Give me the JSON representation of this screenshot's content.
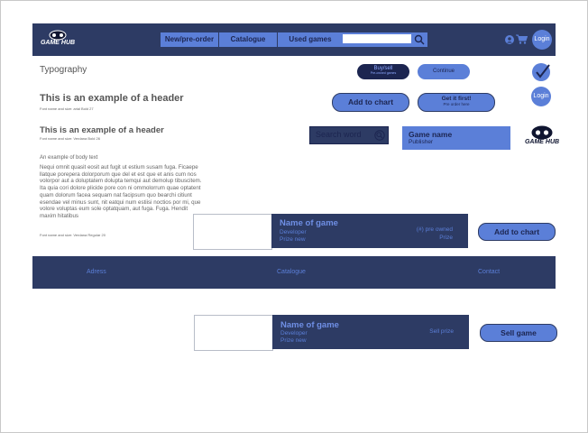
{
  "header": {
    "logo_text": "GAME HUB",
    "nav": [
      "New/pre-order",
      "Catalogue",
      "Used games"
    ],
    "search_placeholder": "",
    "login": "Login"
  },
  "typography": {
    "title": "Typography",
    "h1": "This is an example of a header",
    "h1_font": "Font name and size: arial Bold 27",
    "h2": "This is an example of a header",
    "h2_font": "Font name and size: Verdana Bold 26",
    "body_label": "An example of body text",
    "body_text": "Nequi omnit quasit eosit aut fugit ut estium susam fuga. Ficaepe llatque porepera dolorporum que del et est que et anis cum nos volorpor aut a doluptatem dolupta temqui aut demolup tibuscitem. Ita quia cori dolore plicide pore con ni ommolorrum quae optatent quam dolorum facea sequam nat facipsum quo bearchi citiunt esendae vel minus sunt, nit eatqui num estiisi noctios por mi, que volore voluptas eum sole optatquam, aut fuga. Fuga. Hendit maxim hitatibus",
    "body_font": "Font name and size: Verdana Regular 20"
  },
  "buttons": {
    "buysell": "Buy/sell",
    "buysell_sub": "Pre-owned games",
    "continue": "Continue",
    "add_to_chart": "Add to chart",
    "get_it_first": "Get it first!",
    "pre_order_here": "Pre order here",
    "login": "Login",
    "search_word": "Search word"
  },
  "game_card": {
    "name": "Game name",
    "publisher": "Publisher"
  },
  "listing1": {
    "name": "Name of game",
    "developer": "Developer",
    "prize_new": "Prize new",
    "pre_owned": "(#) pre owned",
    "prize": "Prize",
    "button": "Add to chart"
  },
  "footer": {
    "address": "Adress",
    "catalogue": "Catalogue",
    "contact": "Contact"
  },
  "listing2": {
    "name": "Name of game",
    "developer": "Developer",
    "prize_new": "Prize new",
    "sell_prize": "Sell prize",
    "button": "Sell game"
  },
  "colors": {
    "navy": "#2d3b64",
    "accent_blue": "#5b7fd8",
    "dark_navy": "#1c2550"
  }
}
